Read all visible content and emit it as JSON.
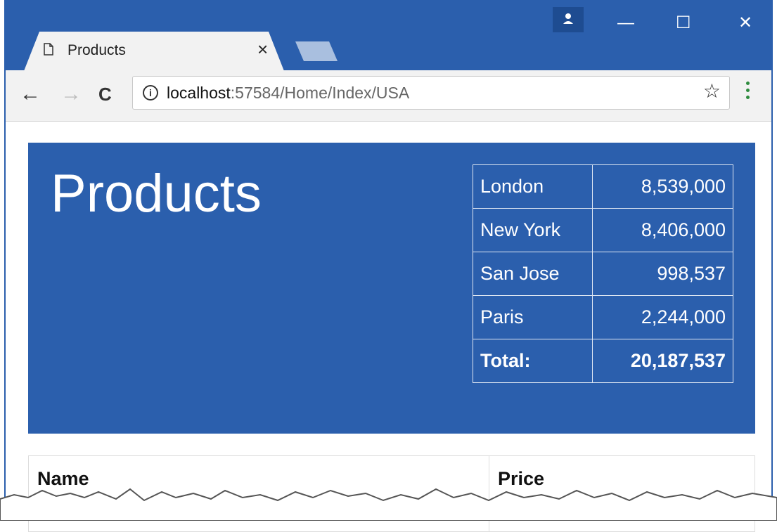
{
  "browser": {
    "tab_title": "Products",
    "tab_close": "×",
    "url_host": "localhost",
    "url_path": ":57584/Home/Index/USA",
    "info_glyph": "i",
    "star_glyph": "☆",
    "back_glyph": "←",
    "forward_glyph": "→",
    "reload_glyph": "C",
    "minimize_glyph": "—",
    "maximize_glyph": "☐",
    "close_glyph": "✕"
  },
  "page": {
    "title": "Products",
    "cities": [
      {
        "name": "London",
        "population": "8,539,000"
      },
      {
        "name": "New York",
        "population": "8,406,000"
      },
      {
        "name": "San Jose",
        "population": "998,537"
      },
      {
        "name": "Paris",
        "population": "2,244,000"
      }
    ],
    "total_label": "Total:",
    "total_value": "20,187,537",
    "table_headers": [
      "Name",
      "Price"
    ]
  },
  "colors": {
    "brand_blue": "#2b5fad",
    "menu_green": "#2e8b3e"
  }
}
